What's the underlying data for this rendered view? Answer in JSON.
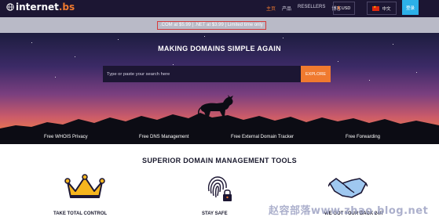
{
  "header": {
    "logo_text": "internet",
    "logo_tld": ".bs",
    "nav": [
      {
        "label": "主页",
        "active": true
      },
      {
        "label": "产品",
        "active": false
      },
      {
        "label": "RESELLERS",
        "active": false
      },
      {
        "label": "博客",
        "active": false
      }
    ],
    "currency_symbol": "$",
    "currency": "USD",
    "language": "中文",
    "login_label": "登录"
  },
  "promo": {
    "text": ".COM at $5.99 | .NET at $3.99 | Limited time only"
  },
  "hero": {
    "headline": "MAKING DOMAINS SIMPLE AGAIN",
    "search_placeholder": "Type or paste your search here",
    "explore_label": "EXPLORE"
  },
  "features": [
    "Free WHOIS Privacy",
    "Free DNS Management",
    "Free External Domain Tracker",
    "Free Forwarding"
  ],
  "tools": {
    "title": "SUPERIOR DOMAIN MANAGEMENT TOOLS",
    "cards": [
      {
        "label": "TAKE TOTAL CONTROL",
        "icon": "crown-icon"
      },
      {
        "label": "STAY SAFE",
        "icon": "fingerprint-lock-icon"
      },
      {
        "label": "WE GOT YOUR BACK 24/7",
        "icon": "handshake-icon"
      }
    ]
  },
  "watermark": "赵容部落www.zhao.blog.net",
  "colors": {
    "accent": "#f07a2f",
    "header_bg": "#1c1633",
    "login_blue": "#2cb0e8",
    "promo_border": "#d63a3a"
  }
}
